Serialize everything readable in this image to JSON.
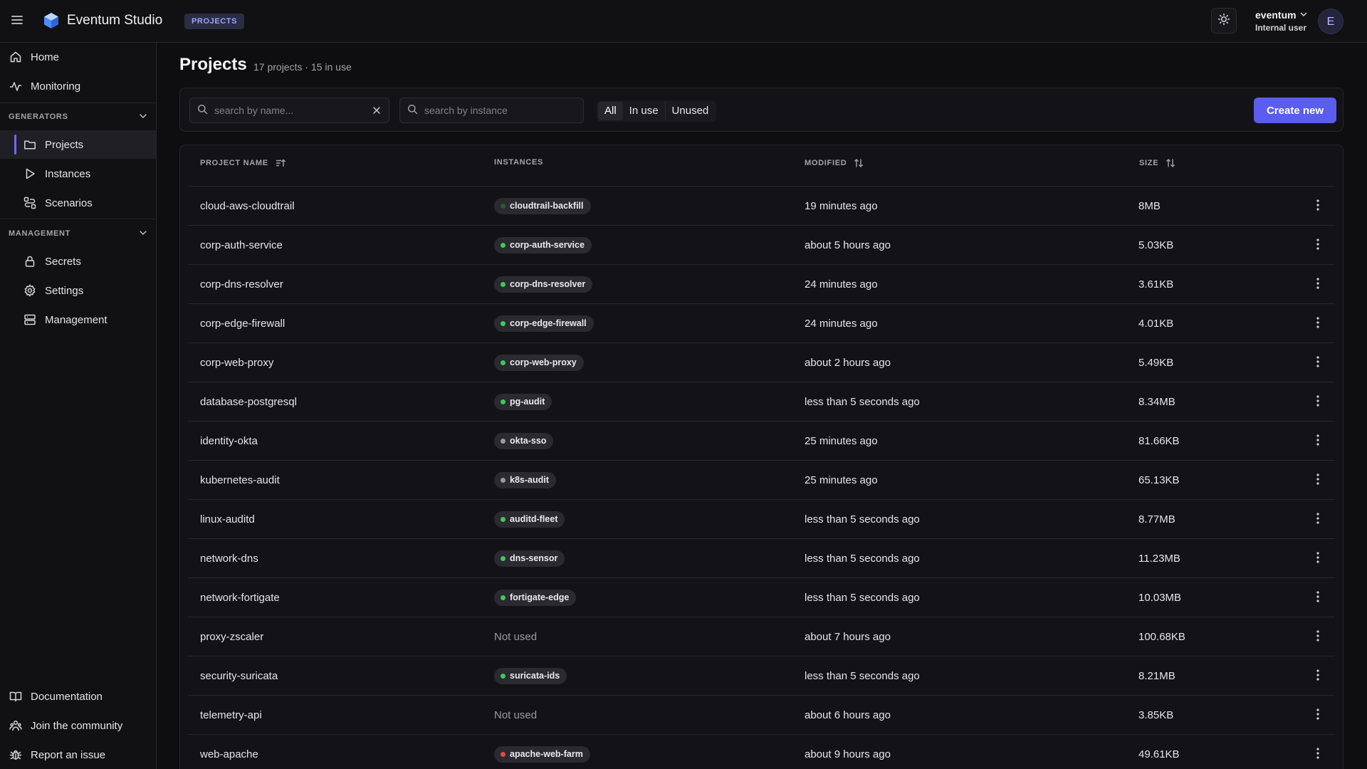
{
  "app": {
    "title": "Eventum Studio",
    "breadcrumb": "PROJECTS"
  },
  "user": {
    "name": "eventum",
    "role": "Internal user",
    "initial": "E"
  },
  "sidebar": {
    "home": "Home",
    "monitoring": "Monitoring",
    "generators_header": "GENERATORS",
    "projects": "Projects",
    "instances": "Instances",
    "scenarios": "Scenarios",
    "management_header": "MANAGEMENT",
    "secrets": "Secrets",
    "settings": "Settings",
    "management": "Management",
    "documentation": "Documentation",
    "community": "Join the community",
    "report": "Report an issue"
  },
  "page": {
    "title": "Projects",
    "subtitle": "17 projects · 15 in use"
  },
  "toolbar": {
    "search_name_placeholder": "search by name...",
    "search_instance_placeholder": "search by instance",
    "filters": [
      "All",
      "In use",
      "Unused"
    ],
    "active_filter": "All",
    "create_label": "Create new"
  },
  "table": {
    "headers": {
      "name": "PROJECT NAME",
      "instances": "INSTANCES",
      "modified": "MODIFIED",
      "size": "SIZE"
    },
    "not_used_label": "Not used",
    "rows": [
      {
        "name": "cloud-aws-cloudtrail",
        "instance": "cloudtrail-backfill",
        "status": "idle",
        "modified": "19 minutes ago",
        "size": "8MB"
      },
      {
        "name": "corp-auth-service",
        "instance": "corp-auth-service",
        "status": "running",
        "modified": "about 5 hours ago",
        "size": "5.03KB"
      },
      {
        "name": "corp-dns-resolver",
        "instance": "corp-dns-resolver",
        "status": "running",
        "modified": "24 minutes ago",
        "size": "3.61KB"
      },
      {
        "name": "corp-edge-firewall",
        "instance": "corp-edge-firewall",
        "status": "running",
        "modified": "24 minutes ago",
        "size": "4.01KB"
      },
      {
        "name": "corp-web-proxy",
        "instance": "corp-web-proxy",
        "status": "running",
        "modified": "about 2 hours ago",
        "size": "5.49KB"
      },
      {
        "name": "database-postgresql",
        "instance": "pg-audit",
        "status": "running",
        "modified": "less than 5 seconds ago",
        "size": "8.34MB"
      },
      {
        "name": "identity-okta",
        "instance": "okta-sso",
        "status": "stopped",
        "modified": "25 minutes ago",
        "size": "81.66KB"
      },
      {
        "name": "kubernetes-audit",
        "instance": "k8s-audit",
        "status": "stopped",
        "modified": "25 minutes ago",
        "size": "65.13KB"
      },
      {
        "name": "linux-auditd",
        "instance": "auditd-fleet",
        "status": "running",
        "modified": "less than 5 seconds ago",
        "size": "8.77MB"
      },
      {
        "name": "network-dns",
        "instance": "dns-sensor",
        "status": "running",
        "modified": "less than 5 seconds ago",
        "size": "11.23MB"
      },
      {
        "name": "network-fortigate",
        "instance": "fortigate-edge",
        "status": "running",
        "modified": "less than 5 seconds ago",
        "size": "10.03MB"
      },
      {
        "name": "proxy-zscaler",
        "instance": "",
        "status": "none",
        "modified": "about 7 hours ago",
        "size": "100.68KB"
      },
      {
        "name": "security-suricata",
        "instance": "suricata-ids",
        "status": "running",
        "modified": "less than 5 seconds ago",
        "size": "8.21MB"
      },
      {
        "name": "telemetry-api",
        "instance": "",
        "status": "none",
        "modified": "about 6 hours ago",
        "size": "3.85KB"
      },
      {
        "name": "web-apache",
        "instance": "apache-web-farm",
        "status": "error",
        "modified": "about 9 hours ago",
        "size": "49.61KB"
      }
    ]
  },
  "colors": {
    "accent": "#5b5cf0",
    "running": "#3ec95c",
    "stopped": "#9a9aa3",
    "idle": "#2d5a34",
    "error": "#e5484d"
  }
}
